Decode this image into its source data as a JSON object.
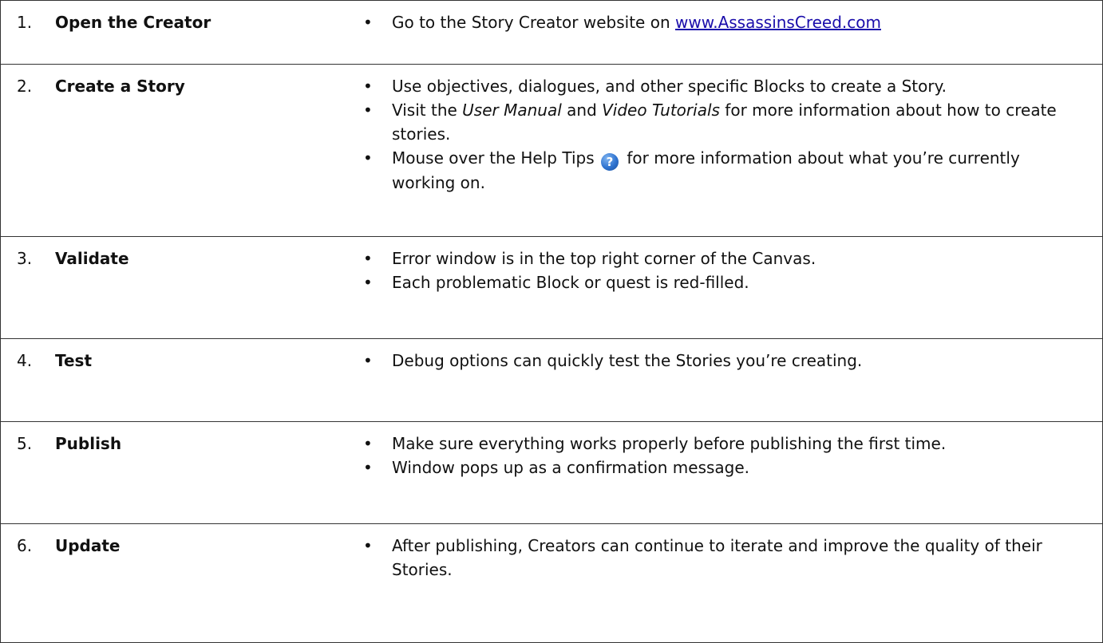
{
  "steps": [
    {
      "number": "1.",
      "title": "Open the Creator",
      "bullets": [
        {
          "before": "Go to the Story Creator website on ",
          "link": "www.AssassinsCreed.com"
        }
      ]
    },
    {
      "number": "2.",
      "title": "Create a Story",
      "bullets": [
        {
          "text": "Use objectives, dialogues, and other specific Blocks to create a Story."
        },
        {
          "pre": "Visit the ",
          "em1": "User Manual",
          "mid": " and ",
          "em2": "Video Tutorials",
          "post": " for more information about how to create stories."
        },
        {
          "before_icon": "Mouse over the Help Tips ",
          "icon": "help-icon",
          "icon_glyph": "?",
          "after_icon": " for more information about what you’re currently working on."
        }
      ]
    },
    {
      "number": "3.",
      "title": "Validate",
      "bullets": [
        {
          "text": "Error window is in the top right corner of the Canvas."
        },
        {
          "text": "Each problematic Block or quest is red-filled."
        }
      ]
    },
    {
      "number": "4.",
      "title": "Test",
      "bullets": [
        {
          "text": "Debug options can quickly test the Stories you’re creating."
        }
      ]
    },
    {
      "number": "5.",
      "title": "Publish",
      "bullets": [
        {
          "text": "Make sure everything works properly before publishing the first time."
        },
        {
          "text": "Window pops up as a confirmation message."
        }
      ]
    },
    {
      "number": "6.",
      "title": "Update",
      "bullets": [
        {
          "text": "After publishing, Creators can continue to iterate and improve the quality of their Stories."
        }
      ]
    }
  ],
  "bullet_symbol": "•",
  "colors": {
    "link": "#1a0dab",
    "border": "#333333",
    "help_icon": "#2f73d0"
  }
}
